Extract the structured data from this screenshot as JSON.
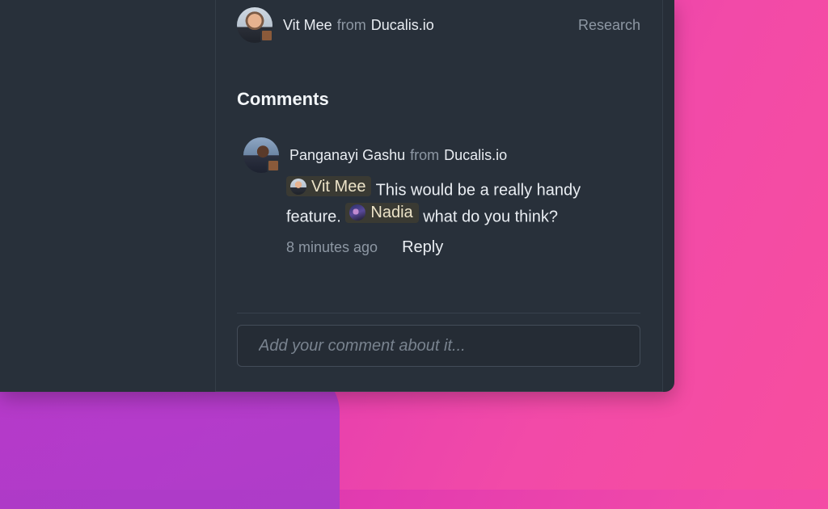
{
  "post": {
    "author_name": "Vit Mee",
    "from_word": "from",
    "author_org": "Ducalis.io",
    "category": "Research"
  },
  "comments_section": {
    "title": "Comments",
    "items": [
      {
        "author_name": "Panganayi Gashu",
        "from_word": "from",
        "author_org": "Ducalis.io",
        "mention1": "Vit Mee",
        "text1": "This would be a really handy feature.",
        "mention2": "Nadia",
        "text2": "what do you think?",
        "time": "8 minutes ago",
        "reply_label": "Reply"
      }
    ]
  },
  "composer": {
    "placeholder": "Add your comment about it..."
  },
  "colors": {
    "panel": "#28303a",
    "mention_bg": "#3a3a33",
    "muted_text": "#8d97a3"
  }
}
